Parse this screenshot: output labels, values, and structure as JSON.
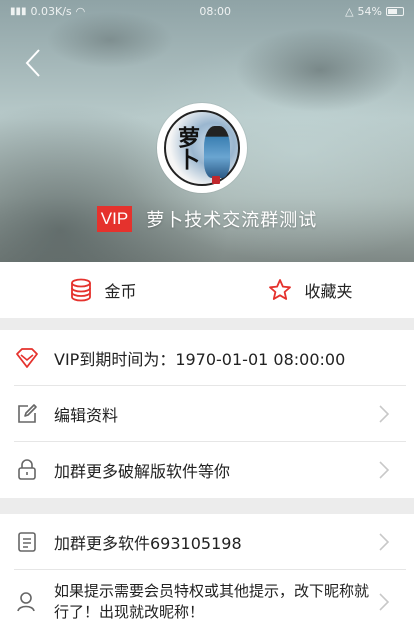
{
  "status_bar": {
    "left_text": "0.03K/s",
    "time": "08:00",
    "battery": "54%"
  },
  "profile": {
    "vip_badge": "VIP",
    "username": "萝卜技术交流群测试",
    "avatar_char": "萝卜"
  },
  "quick_actions": [
    {
      "label": "金币",
      "icon": "coins-icon"
    },
    {
      "label": "收藏夹",
      "icon": "star-icon"
    }
  ],
  "menu_group1": [
    {
      "label": "VIP到期时间为：1970-01-01 08:00:00",
      "icon": "diamond-icon",
      "chevron": false
    },
    {
      "label": "编辑资料",
      "icon": "edit-icon",
      "chevron": true
    },
    {
      "label": "加群更多破解版软件等你",
      "icon": "lock-icon",
      "chevron": true
    }
  ],
  "menu_group2": [
    {
      "label": "加群更多软件693105198",
      "icon": "document-icon",
      "chevron": true
    },
    {
      "label": "如果提示需要会员特权或其他提示，改下昵称就行了！出现就改昵称！",
      "icon": "user-icon",
      "chevron": true
    }
  ],
  "colors": {
    "accent": "#e5322d",
    "icon_gray": "#666666"
  }
}
